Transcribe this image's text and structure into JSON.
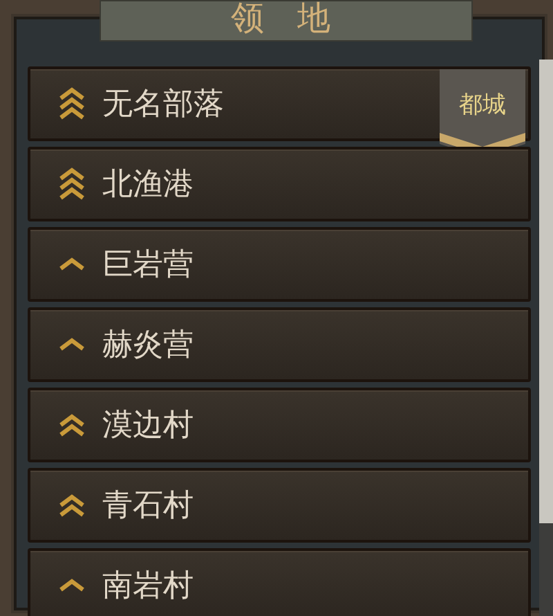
{
  "header": {
    "title": "领 地"
  },
  "territories": [
    {
      "name": "无名部落",
      "kind": "triple",
      "badge": "都城"
    },
    {
      "name": "北渔港",
      "kind": "triple"
    },
    {
      "name": "巨岩营",
      "kind": "single"
    },
    {
      "name": "赫炎营",
      "kind": "single"
    },
    {
      "name": "漠边村",
      "kind": "double"
    },
    {
      "name": "青石村",
      "kind": "double"
    },
    {
      "name": "南岩村",
      "kind": "single"
    }
  ]
}
